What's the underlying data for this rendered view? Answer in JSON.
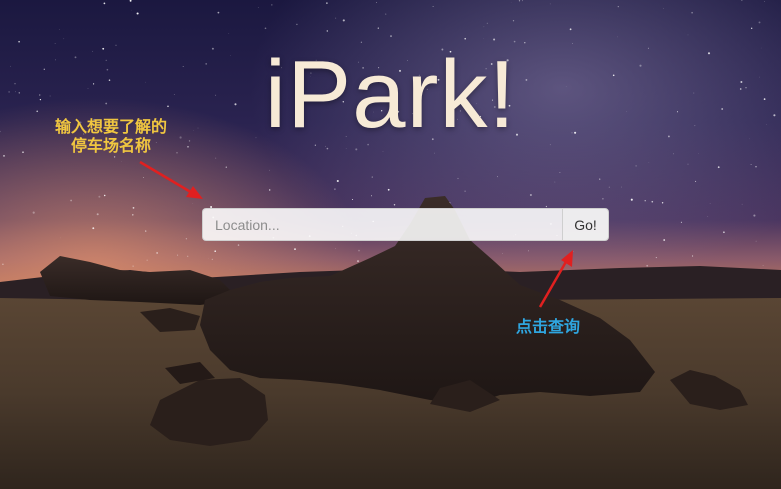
{
  "app": {
    "title": "iPark!"
  },
  "search": {
    "placeholder": "Location...",
    "button_label": "Go!"
  },
  "annotations": {
    "left_line1": "输入想要了解的",
    "left_line2": "停车场名称",
    "right": "点击查询"
  },
  "colors": {
    "title": "#f7ead6",
    "annotation_yellow": "#f0c640",
    "annotation_blue": "#2fa6e0",
    "arrow_red": "#e02020"
  }
}
